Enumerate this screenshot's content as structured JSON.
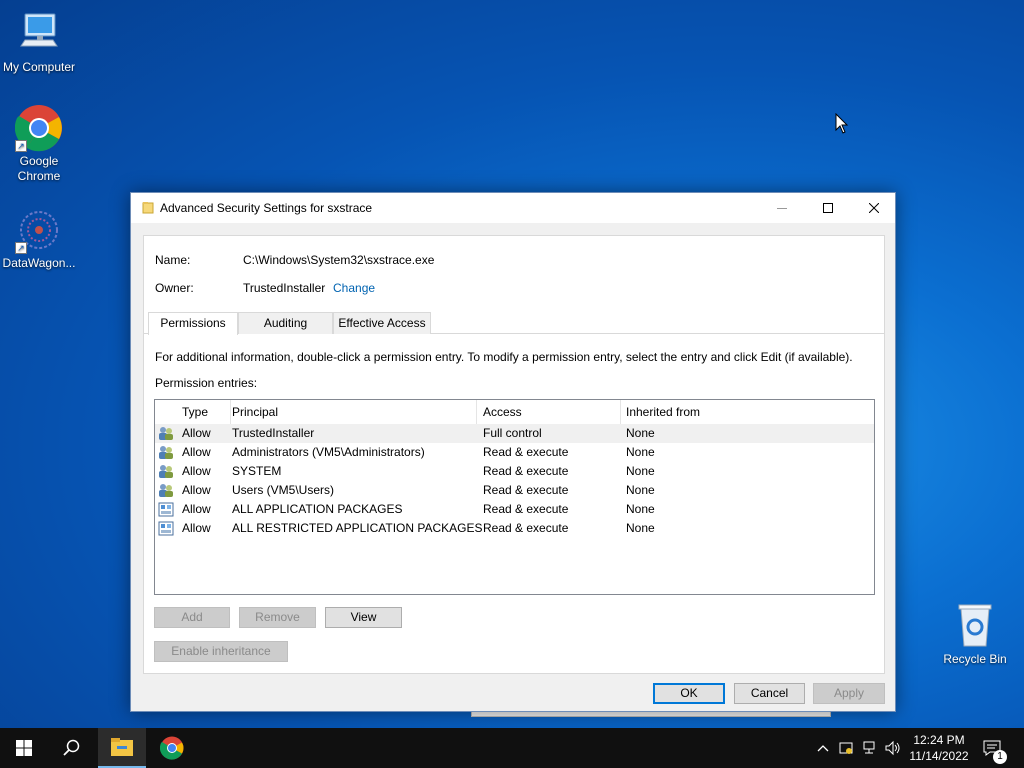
{
  "desktop": {
    "icons": [
      {
        "label": "My Computer"
      },
      {
        "label": "Google Chrome"
      },
      {
        "label": "DataWagon..."
      },
      {
        "label": "Recycle Bin"
      }
    ]
  },
  "dialog": {
    "title": "Advanced Security Settings for sxstrace",
    "name_label": "Name:",
    "name_value": "C:\\Windows\\System32\\sxstrace.exe",
    "owner_label": "Owner:",
    "owner_value": "TrustedInstaller",
    "change_link": "Change",
    "tabs": [
      {
        "label": "Permissions",
        "active": true
      },
      {
        "label": "Auditing",
        "active": false
      },
      {
        "label": "Effective Access",
        "active": false
      }
    ],
    "info_text": "For additional information, double-click a permission entry. To modify a permission entry, select the entry and click Edit (if available).",
    "entries_label": "Permission entries:",
    "columns": [
      "Type",
      "Principal",
      "Access",
      "Inherited from"
    ],
    "entries": [
      {
        "icon": "users-icon",
        "type": "Allow",
        "principal": "TrustedInstaller",
        "access": "Full control",
        "inherited": "None"
      },
      {
        "icon": "users-icon",
        "type": "Allow",
        "principal": "Administrators (VM5\\Administrators)",
        "access": "Read & execute",
        "inherited": "None"
      },
      {
        "icon": "users-icon",
        "type": "Allow",
        "principal": "SYSTEM",
        "access": "Read & execute",
        "inherited": "None"
      },
      {
        "icon": "users-icon",
        "type": "Allow",
        "principal": "Users (VM5\\Users)",
        "access": "Read & execute",
        "inherited": "None"
      },
      {
        "icon": "package-icon",
        "type": "Allow",
        "principal": "ALL APPLICATION PACKAGES",
        "access": "Read & execute",
        "inherited": "None"
      },
      {
        "icon": "package-icon",
        "type": "Allow",
        "principal": "ALL RESTRICTED APPLICATION PACKAGES",
        "access": "Read & execute",
        "inherited": "None"
      }
    ],
    "buttons": {
      "add": "Add",
      "remove": "Remove",
      "view": "View",
      "enable_inheritance": "Enable inheritance",
      "ok": "OK",
      "cancel": "Cancel",
      "apply": "Apply"
    }
  },
  "taskbar": {
    "time": "12:24 PM",
    "date": "11/14/2022",
    "notification_count": "1"
  },
  "colors": {
    "accent": "#0078d7",
    "link": "#0063b1",
    "taskbar": "#101010"
  }
}
